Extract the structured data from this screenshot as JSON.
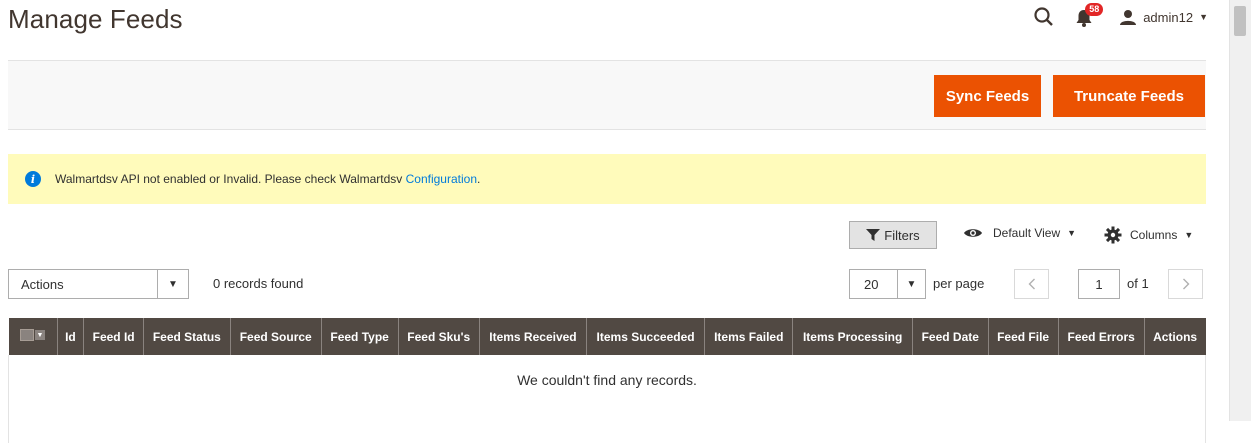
{
  "header": {
    "title": "Manage Feeds",
    "notifications_count": "58",
    "username": "admin12"
  },
  "action_bar": {
    "sync_label": "Sync Feeds",
    "truncate_label": "Truncate Feeds"
  },
  "notice": {
    "text": "Walmartdsv API not enabled or Invalid. Please check Walmartdsv ",
    "link_text": "Configuration",
    "trailing": "."
  },
  "grid_controls": {
    "filters_label": "Filters",
    "view_label": "Default View",
    "columns_label": "Columns",
    "actions_label": "Actions",
    "records_found": "0 records found",
    "per_page_value": "20",
    "per_page_label": "per page",
    "current_page": "1",
    "page_of": "of 1"
  },
  "grid": {
    "columns": [
      "Id",
      "Feed Id",
      "Feed Status",
      "Feed Source",
      "Feed Type",
      "Feed Sku's",
      "Items Received",
      "Items Succeeded",
      "Items Failed",
      "Items Processing",
      "Feed Date",
      "Feed File",
      "Feed Errors",
      "Actions"
    ],
    "empty_message": "We couldn't find any records."
  },
  "colors": {
    "accent": "#eb5202",
    "header_bg": "#514943",
    "notice_bg": "#fffbbb",
    "link": "#007bdb",
    "badge": "#e22626"
  }
}
